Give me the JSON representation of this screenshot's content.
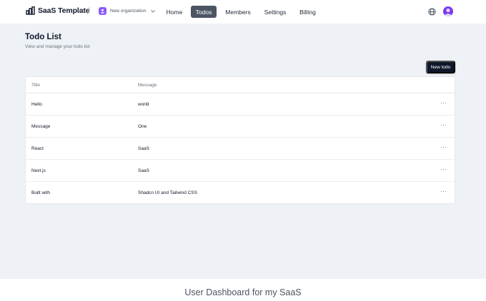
{
  "header": {
    "brand": "SaaS Template",
    "org": "New organization",
    "nav": [
      {
        "label": "Home"
      },
      {
        "label": "Todos",
        "active": true
      },
      {
        "label": "Members"
      },
      {
        "label": "Settings"
      },
      {
        "label": "Billing"
      }
    ],
    "icons": {
      "brand": "bar-chart-icon",
      "language": "globe-icon",
      "account": "user-avatar-icon"
    }
  },
  "page": {
    "title": "Todo List",
    "subtitle": "View and manage your todo list",
    "new_button": "New todo"
  },
  "table": {
    "columns": [
      "Title",
      "Message"
    ],
    "rows": [
      {
        "title": "Hello",
        "message": "world"
      },
      {
        "title": "Message",
        "message": "One"
      },
      {
        "title": "React",
        "message": "SaaS"
      },
      {
        "title": "Next.js",
        "message": "SaaS"
      },
      {
        "title": "Built with",
        "message": "Shadcn UI and Tailwind CSS"
      }
    ],
    "row_action": "···"
  },
  "caption": "User Dashboard for my SaaS",
  "colors": {
    "accent": "#4b5563",
    "brand_badge": "#8b5cf6",
    "primary_button": "#0f172a",
    "app_bg": "#eef1f5"
  }
}
